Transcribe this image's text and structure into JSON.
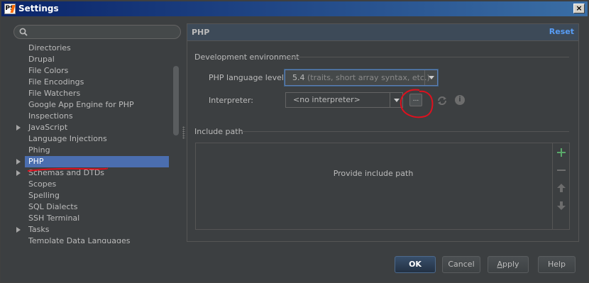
{
  "window": {
    "title": "Settings",
    "close_glyph": "×"
  },
  "search": {
    "placeholder": ""
  },
  "tree": {
    "items": [
      {
        "label": "Directories",
        "expandable": false,
        "selected": false
      },
      {
        "label": "Drupal",
        "expandable": false,
        "selected": false
      },
      {
        "label": "File Colors",
        "expandable": false,
        "selected": false
      },
      {
        "label": "File Encodings",
        "expandable": false,
        "selected": false
      },
      {
        "label": "File Watchers",
        "expandable": false,
        "selected": false
      },
      {
        "label": "Google App Engine for PHP",
        "expandable": false,
        "selected": false
      },
      {
        "label": "Inspections",
        "expandable": false,
        "selected": false
      },
      {
        "label": "JavaScript",
        "expandable": true,
        "selected": false
      },
      {
        "label": "Language Injections",
        "expandable": false,
        "selected": false
      },
      {
        "label": "Phing",
        "expandable": false,
        "selected": false
      },
      {
        "label": "PHP",
        "expandable": true,
        "selected": true
      },
      {
        "label": "Schemas and DTDs",
        "expandable": true,
        "selected": false
      },
      {
        "label": "Scopes",
        "expandable": false,
        "selected": false
      },
      {
        "label": "Spelling",
        "expandable": false,
        "selected": false
      },
      {
        "label": "SQL Dialects",
        "expandable": false,
        "selected": false
      },
      {
        "label": "SSH Terminal",
        "expandable": false,
        "selected": false
      },
      {
        "label": "Tasks",
        "expandable": true,
        "selected": false
      },
      {
        "label": "Template Data Languages",
        "expandable": false,
        "selected": false
      }
    ]
  },
  "panel": {
    "title": "PHP",
    "reset_label": "Reset",
    "dev_env_label": "Development environment",
    "lang_level_label": "PHP language level:",
    "lang_level_value": "5.4",
    "lang_level_hint": "(traits, short array syntax, etc.)",
    "interpreter_label": "Interpreter:",
    "interpreter_value": "<no interpreter>",
    "more_glyph": "...",
    "info_glyph": "i",
    "include_path_label": "Include path",
    "include_empty_text": "Provide include path"
  },
  "buttons": {
    "ok": "OK",
    "cancel": "Cancel",
    "apply": "Apply",
    "help": "Help"
  },
  "colors": {
    "selection": "#4b6eaf",
    "accent_link": "#589df6",
    "add_green": "#59a869",
    "annotation_red": "#e0101e"
  }
}
